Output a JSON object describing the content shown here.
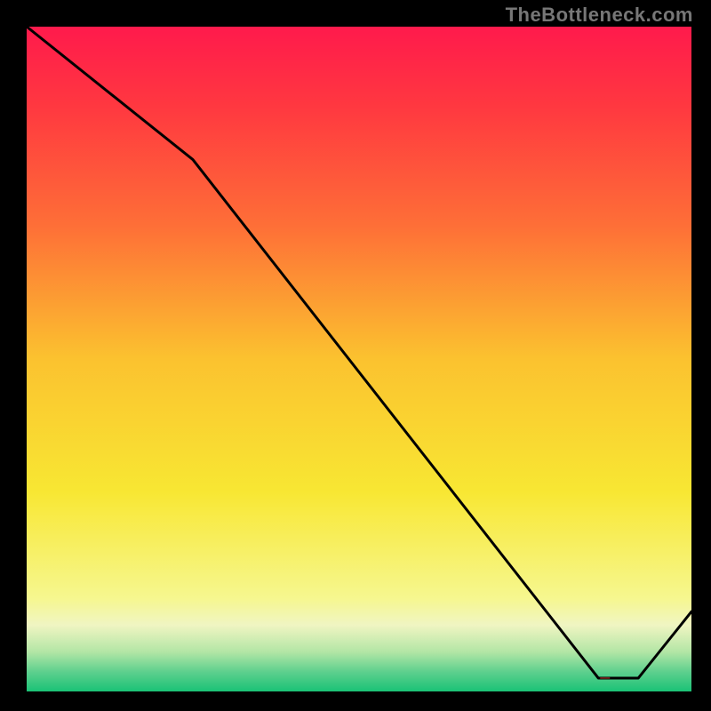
{
  "watermark": "TheBottleneck.com",
  "chart_data": {
    "type": "line",
    "title": "",
    "xlabel": "",
    "ylabel": "",
    "xlim": [
      0,
      100
    ],
    "ylim": [
      0,
      100
    ],
    "x": [
      0,
      25,
      86,
      92,
      100
    ],
    "values": [
      100,
      80,
      2,
      2,
      12
    ],
    "annotation": {
      "text": "—",
      "x_range": [
        82,
        92
      ],
      "y": 2
    },
    "background_gradient": {
      "stops": [
        {
          "pos": 0.0,
          "color": "#ff1a4c"
        },
        {
          "pos": 0.12,
          "color": "#ff3840"
        },
        {
          "pos": 0.3,
          "color": "#fe6f37"
        },
        {
          "pos": 0.5,
          "color": "#fbc22f"
        },
        {
          "pos": 0.7,
          "color": "#f8e733"
        },
        {
          "pos": 0.86,
          "color": "#f6f78f"
        },
        {
          "pos": 0.9,
          "color": "#f0f5c2"
        },
        {
          "pos": 0.94,
          "color": "#b4e6a6"
        },
        {
          "pos": 0.97,
          "color": "#5fd08e"
        },
        {
          "pos": 1.0,
          "color": "#1ac276"
        }
      ]
    }
  },
  "colors": {
    "line": "#000000",
    "annotation": "#b43028",
    "watermark": "#777777",
    "frame": "#000000"
  }
}
